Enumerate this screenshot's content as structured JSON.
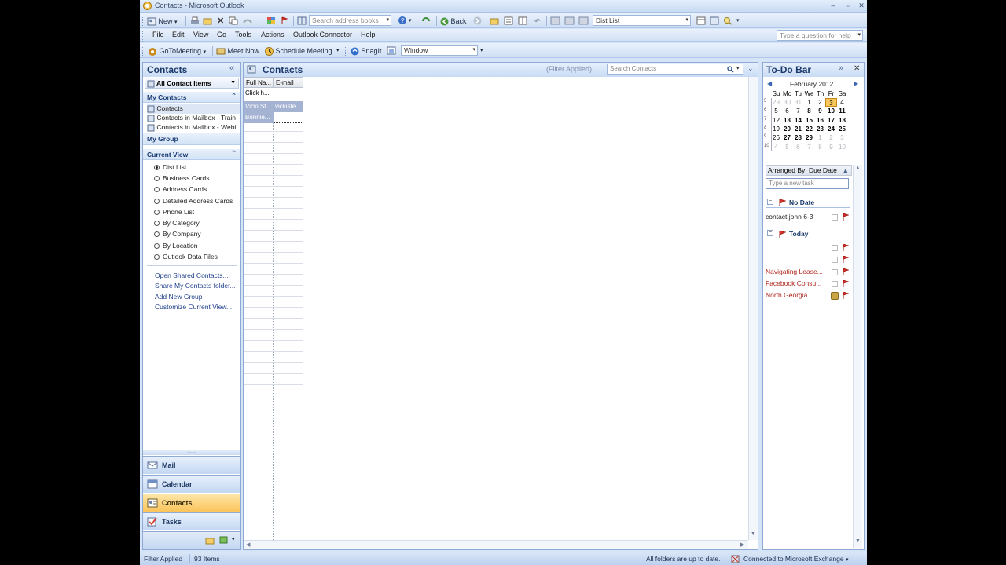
{
  "window": {
    "title": "Contacts - Microsoft Outlook"
  },
  "toolbar1": {
    "new_label": "New",
    "search_address_placeholder": "Search address books",
    "back_label": "Back",
    "view_combo": "Dist List"
  },
  "menu": [
    "File",
    "Edit",
    "View",
    "Go",
    "Tools",
    "Actions",
    "Outlook Connector",
    "Help"
  ],
  "help_box": "Type a question for help",
  "toolbar3": {
    "gotomeeting": "GoToMeeting",
    "meet_now": "Meet Now",
    "schedule": "Schedule Meeting",
    "snagit": "SnagIt",
    "window_combo": "Window"
  },
  "nav": {
    "title": "Contacts",
    "filter": "All Contact Items",
    "my_contacts": "My Contacts",
    "folders": [
      "Contacts",
      "Contacts in Mailbox - Train",
      "Contacts in Mailbox - Webi"
    ],
    "my_group": "My Group",
    "current_view": "Current View",
    "views": [
      "Dist List",
      "Business Cards",
      "Address Cards",
      "Detailed Address Cards",
      "Phone List",
      "By Category",
      "By Company",
      "By Location",
      "Outlook Data Files"
    ],
    "links": [
      "Open Shared Contacts...",
      "Share My Contacts folder...",
      "Add New Group",
      "Customize Current View..."
    ],
    "buttons": [
      "Mail",
      "Calendar",
      "Contacts",
      "Tasks"
    ]
  },
  "content": {
    "title": "Contacts",
    "filter_applied": "(Filter Applied)",
    "search_placeholder": "Search Contacts",
    "columns": [
      "Full Na...",
      "E-mail"
    ],
    "click_here": "Click h...",
    "rows": [
      {
        "name": "Vicki St...",
        "email": "vickiste..."
      },
      {
        "name": "Bonnie...",
        "email": ""
      }
    ]
  },
  "todo": {
    "title": "To-Do Bar",
    "month": "February 2012",
    "weekdays": [
      "Su",
      "Mo",
      "Tu",
      "We",
      "Th",
      "Fr",
      "Sa"
    ],
    "weeks": [
      {
        "num": "5",
        "days": [
          "29",
          "30",
          "31",
          "1",
          "2",
          "3",
          "4"
        ]
      },
      {
        "num": "6",
        "days": [
          "5",
          "6",
          "7",
          "8",
          "9",
          "10",
          "11"
        ]
      },
      {
        "num": "7",
        "days": [
          "12",
          "13",
          "14",
          "15",
          "16",
          "17",
          "18"
        ]
      },
      {
        "num": "8",
        "days": [
          "19",
          "20",
          "21",
          "22",
          "23",
          "24",
          "25"
        ]
      },
      {
        "num": "9",
        "days": [
          "26",
          "27",
          "28",
          "29",
          "1",
          "2",
          "3"
        ]
      },
      {
        "num": "10",
        "days": [
          "4",
          "5",
          "6",
          "7",
          "8",
          "9",
          "10"
        ]
      }
    ],
    "arranged_by": "Arranged By: Due Date",
    "new_task_placeholder": "Type a new task",
    "groups": [
      {
        "name": "No Date",
        "tasks": [
          "contact john 6-3"
        ]
      },
      {
        "name": "Today",
        "tasks": [
          "",
          "",
          "Navigating Lease...",
          "Facebook Consu...",
          "North Georgia"
        ]
      }
    ]
  },
  "status": {
    "filter": "Filter Applied",
    "count": "93 Items",
    "sync": "All folders are up to date.",
    "connection": "Connected to Microsoft Exchange"
  }
}
